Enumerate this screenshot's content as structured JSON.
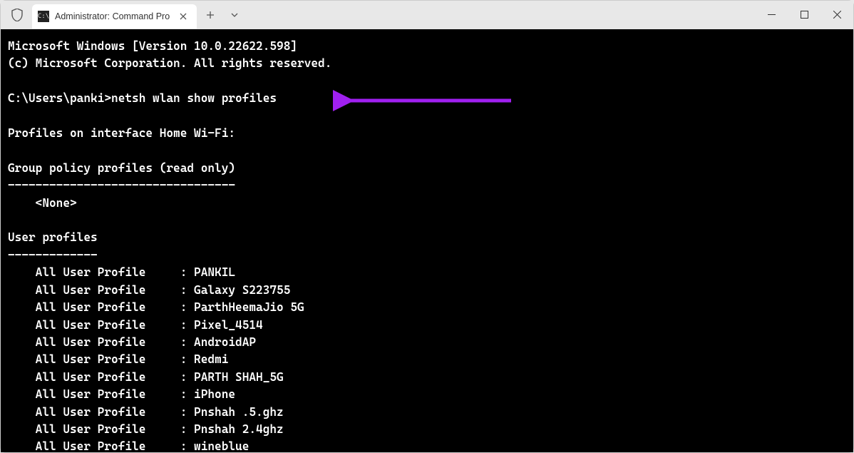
{
  "window": {
    "tab_title": "Administrator: Command Pro",
    "tab_icon": "C:\\",
    "new_tab": "+",
    "dropdown": "v",
    "close_glyph": "×"
  },
  "terminal": {
    "banner_line1": "Microsoft Windows [Version 10.0.22622.598]",
    "banner_line2": "(c) Microsoft Corporation. All rights reserved.",
    "prompt": "C:\\Users\\panki>",
    "command": "netsh wlan show profiles",
    "heading_interface": "Profiles on interface Home Wi-Fi:",
    "heading_group": "Group policy profiles (read only)",
    "divider_group": "---------------------------------",
    "group_none": "    <None>",
    "heading_user": "User profiles",
    "divider_user": "-------------",
    "profile_label": "    All User Profile",
    "sep": "     : ",
    "profiles": [
      "PANKIL",
      "Galaxy S223755",
      "ParthHeemaJio 5G",
      "Pixel_4514",
      "AndroidAP",
      "Redmi",
      "PARTH SHAH_5G",
      "iPhone",
      "Pnshah .5.ghz",
      "Pnshah 2.4ghz",
      "wineblue"
    ]
  },
  "annotation": {
    "color": "#a020f0"
  }
}
